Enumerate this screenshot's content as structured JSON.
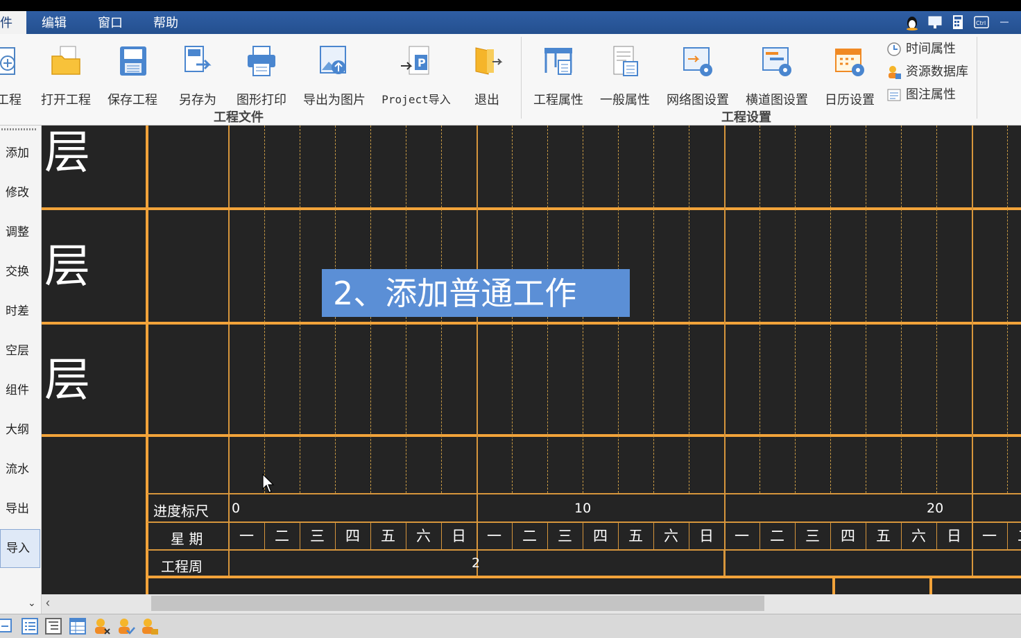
{
  "menubar": {
    "items": [
      "件",
      "编辑",
      "窗口",
      "帮助"
    ]
  },
  "ribbon": {
    "groups": [
      {
        "label": "工程文件"
      },
      {
        "label": "工程设置"
      }
    ],
    "buttons": [
      {
        "label": "工程",
        "icon": "new-project-icon"
      },
      {
        "label": "打开工程",
        "icon": "open-folder-icon"
      },
      {
        "label": "保存工程",
        "icon": "save-icon"
      },
      {
        "label": "另存为",
        "icon": "save-as-icon"
      },
      {
        "label": "图形打印",
        "icon": "print-icon"
      },
      {
        "label": "导出为图片",
        "icon": "export-image-icon"
      },
      {
        "label": "Project导入",
        "icon": "project-import-icon"
      },
      {
        "label": "退出",
        "icon": "exit-icon"
      },
      {
        "label": "工程属性",
        "icon": "project-properties-icon"
      },
      {
        "label": "一般属性",
        "icon": "general-properties-icon"
      },
      {
        "label": "网络图设置",
        "icon": "network-settings-icon"
      },
      {
        "label": "横道图设置",
        "icon": "gantt-settings-icon"
      },
      {
        "label": "日历设置",
        "icon": "calendar-settings-icon"
      }
    ],
    "small_buttons": [
      {
        "label": "时间属性",
        "icon": "clock-icon"
      },
      {
        "label": "资源数据库",
        "icon": "resource-database-icon"
      },
      {
        "label": "图注属性",
        "icon": "legend-properties-icon"
      }
    ]
  },
  "left_panel": {
    "items": [
      "添加",
      "修改",
      "调整",
      "交换",
      "时差",
      "空层",
      "组件",
      "大纲",
      "流水",
      "导出",
      "导入"
    ],
    "selected": "导入"
  },
  "canvas": {
    "layer_label": "层",
    "ruler": {
      "progress_label": "进度标尺",
      "weekday_label": "星 期",
      "week_label": "工程周",
      "tick_numbers": [
        "0",
        "10",
        "20"
      ],
      "weekdays": [
        "一",
        "二",
        "三",
        "四",
        "五",
        "六",
        "日",
        "一",
        "二",
        "三",
        "四",
        "五",
        "六",
        "日",
        "一",
        "二",
        "三",
        "四",
        "五",
        "六",
        "日",
        "一",
        "二"
      ],
      "week_number": "2"
    }
  },
  "caption": "2、添加普通工作",
  "colors": {
    "menubar": "#2f5ea4",
    "grid_line": "#f2a33a",
    "canvas_bg": "#242424",
    "caption_bg": "#5b8fd6"
  }
}
